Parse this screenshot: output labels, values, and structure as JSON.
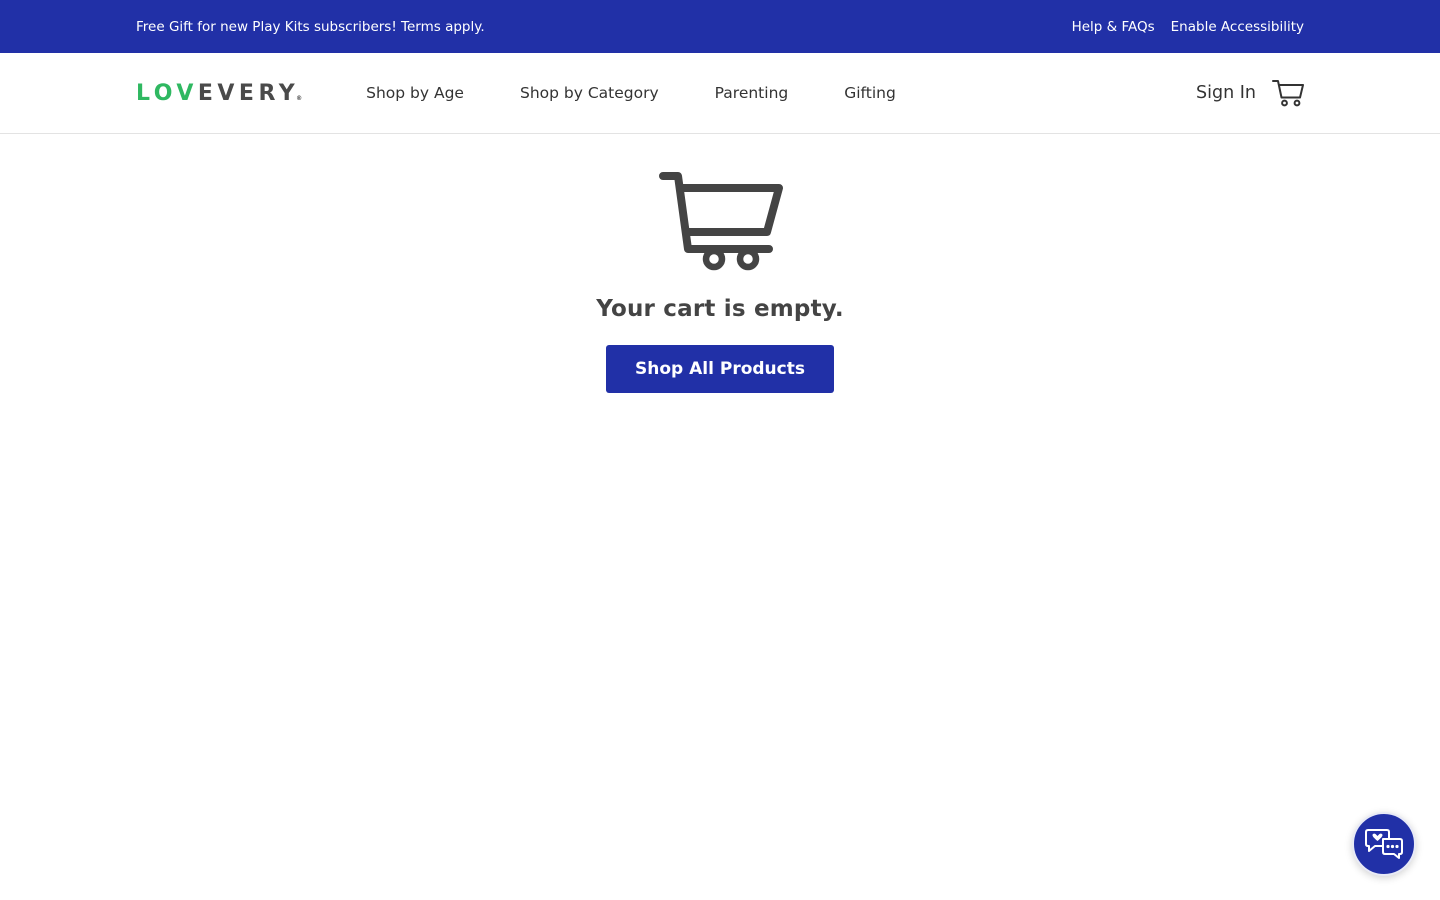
{
  "promo": {
    "message": "Free Gift for new Play Kits subscribers! Terms apply.",
    "links": [
      "Help & FAQs",
      "Enable Accessibility"
    ]
  },
  "header": {
    "logo_part1": "LOV",
    "logo_part2": "EVERY",
    "logo_mark": "®",
    "nav": [
      "Shop by Age",
      "Shop by Category",
      "Parenting",
      "Gifting"
    ],
    "sign_in": "Sign In",
    "cart_icon": "shopping-cart-icon"
  },
  "main": {
    "cart_icon": "shopping-cart-icon",
    "empty_message": "Your cart is empty.",
    "shop_button": "Shop All Products"
  },
  "chat": {
    "icon": "chat-bubbles-icon"
  },
  "colors": {
    "brand_blue": "#2130a7",
    "logo_green": "#2fb861",
    "text_dark": "#333333"
  }
}
